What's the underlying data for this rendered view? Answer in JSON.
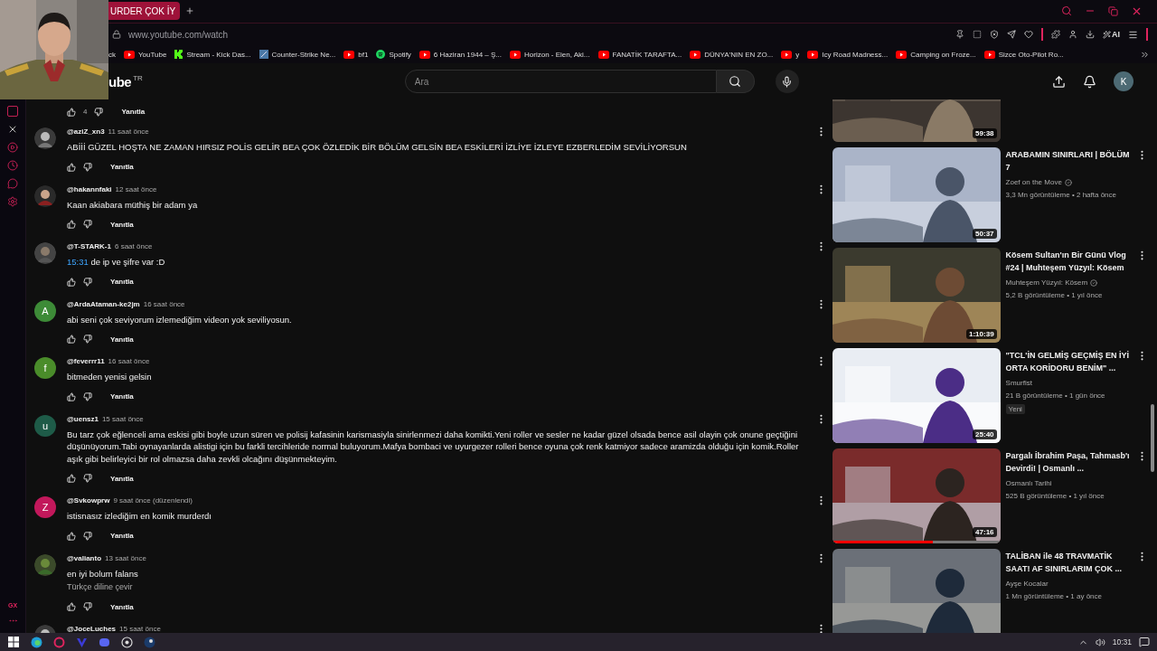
{
  "browser": {
    "tab": {
      "title": "URDER ÇOK İY",
      "selected": true
    },
    "address": "www.youtube.com/watch",
    "ai_button": "AI",
    "bookmarks": [
      {
        "label": "ck",
        "kind": "plain"
      },
      {
        "label": "YouTube",
        "kind": "youtube"
      },
      {
        "label": "Stream - Kick Das...",
        "kind": "kick"
      },
      {
        "label": "Counter-Strike Ne...",
        "kind": "page"
      },
      {
        "label": "bf1",
        "kind": "youtube"
      },
      {
        "label": "Spotify",
        "kind": "spotify"
      },
      {
        "label": "6 Haziran 1944 – Ş...",
        "kind": "youtube"
      },
      {
        "label": "Horizon - Eien, Aki...",
        "kind": "youtube"
      },
      {
        "label": "FANATİK TARAFTA...",
        "kind": "youtube"
      },
      {
        "label": "DÜNYA'NIN EN ZO...",
        "kind": "youtube"
      },
      {
        "label": "y",
        "kind": "youtube"
      },
      {
        "label": "Icy Road Madness...",
        "kind": "youtube"
      },
      {
        "label": "Camping on Froze...",
        "kind": "youtube"
      },
      {
        "label": "Sizce Oto-Pilot Ro...",
        "kind": "youtube"
      }
    ],
    "sidebar_footer": "GX"
  },
  "youtube": {
    "logo_text": "ube",
    "region": "TR",
    "search": {
      "placeholder": "Ara"
    },
    "avatar": "K"
  },
  "previous_comment_actions": {
    "likes": "4",
    "reply": "Yanıtla"
  },
  "comments": [
    {
      "handle": "@aziZ_xn3",
      "time": "11 saat önce",
      "text": "ABİİİ GÜZEL HOŞTA NE ZAMAN HIRSIZ POLİS GELİR BEA ÇOK ÖZLEDİK BİR BÖLÜM GELSİN BEA ESKİLERİ İZLİYE İZLEYE EZBERLEDİM SEVİLİYORSUN",
      "reply": "Yanıtla"
    },
    {
      "handle": "@hakannfaki",
      "time": "12 saat önce",
      "text": "Kaan akiabara müthiş bir adam ya",
      "reply": "Yanıtla"
    },
    {
      "handle": "@T-STARK-1",
      "time": "6 saat önce",
      "timestamp": "15:31",
      "text": "de ip ve şifre var :D",
      "reply": "Yanıtla"
    },
    {
      "avatar": {
        "kind": "letter",
        "letter": "A",
        "color": "#3d8b37"
      },
      "handle": "@ArdaAtaman-ke2jm",
      "time": "16 saat önce",
      "text": "abi seni çok seviyorum izlemediğim videon yok seviliyosun.",
      "reply": "Yanıtla"
    },
    {
      "avatar": {
        "kind": "letter",
        "letter": "f",
        "color": "#4a8c2a"
      },
      "handle": "@feverrr11",
      "time": "16 saat önce",
      "text": "bitmeden  yenisi gelsin",
      "reply": "Yanıtla"
    },
    {
      "avatar": {
        "kind": "letter",
        "letter": "u",
        "color": "#1e5b48"
      },
      "handle": "@uensz1",
      "time": "15 saat önce",
      "text": "Bu tarz çok eğlenceli ama eskisi gibi boyle uzun süren ve polisij kafasinin karismasiyla sinirlenmezi daha komikti.Yeni roller ve sesler ne kadar güzel olsada bence asil olayin çok onune geçtiğini düşünüyorum.Tabi oynayanlarda alistigi için bu farkli tercihleride normal buluyorum.Mafya bombaci  ve uyurgezer rolleri bence oyuna çok renk katmiyor sadece aramizda olduğu için komik.Roller aşık gibi belirleyici bir rol olmazsa daha zevkli olcağını düşünmekteyim.",
      "reply": "Yanıtla"
    },
    {
      "avatar": {
        "kind": "letter",
        "letter": "Z",
        "color": "#c2185b"
      },
      "handle": "@Svkowprw",
      "time": "9 saat önce (düzenlendi)",
      "text": "istisnasız izlediğim en komik murderdı",
      "reply": "Yanıtla"
    },
    {
      "handle": "@valianto",
      "time": "13 saat önce",
      "text": "en iyi bolum falans",
      "translate": "Türkçe diline çevir",
      "reply": "Yanıtla"
    },
    {
      "handle": "@JoceLuches",
      "time": "15 saat önce"
    }
  ],
  "related": [
    {
      "kind": "cut",
      "duration": "59:38"
    },
    {
      "kind": "full",
      "title": "ARABAMIN SINIRLARI | BÖLÜM 7",
      "channel": "Zoef on the Move",
      "verified": true,
      "meta": "3,3 Mn görüntüleme • 2 hafta önce",
      "duration": "50:37"
    },
    {
      "kind": "full",
      "title": "Kösem Sultan'ın Bir Günü Vlog #24 | Muhteşem Yüzyıl: Kösem",
      "channel": "Muhteşem Yüzyıl: Kösem",
      "verified": true,
      "meta": "5,2 B görüntüleme • 1 yıl önce",
      "duration": "1:10:39"
    },
    {
      "kind": "full",
      "title": "\"TCL'İN GELMİŞ GEÇMİŞ EN İYİ ORTA KORİDORU BENİM\" ...",
      "channel": "Smurfist",
      "verified": false,
      "meta": "21 B görüntüleme • 1 gün önce",
      "badge": "Yeni",
      "duration": "25:40"
    },
    {
      "kind": "full",
      "title": "Pargalı İbrahim Paşa, Tahmasb'ı Devirdi! | Osmanlı ...",
      "channel": "Osmanlı Tarihi",
      "verified": false,
      "meta": "525 B görüntüleme • 1 yıl önce",
      "duration": "47:16",
      "progress": {
        "level": 0.6
      }
    },
    {
      "kind": "full",
      "title": "TALİBAN ile 48 TRAVMATİK SAAT! AF SINIRLARIM ÇOK ...",
      "channel": "Ayşe Kocalar",
      "verified": false,
      "meta": "1 Mn görüntüleme • 1 ay önce"
    }
  ],
  "taskbar": {
    "clock": "10:31"
  }
}
